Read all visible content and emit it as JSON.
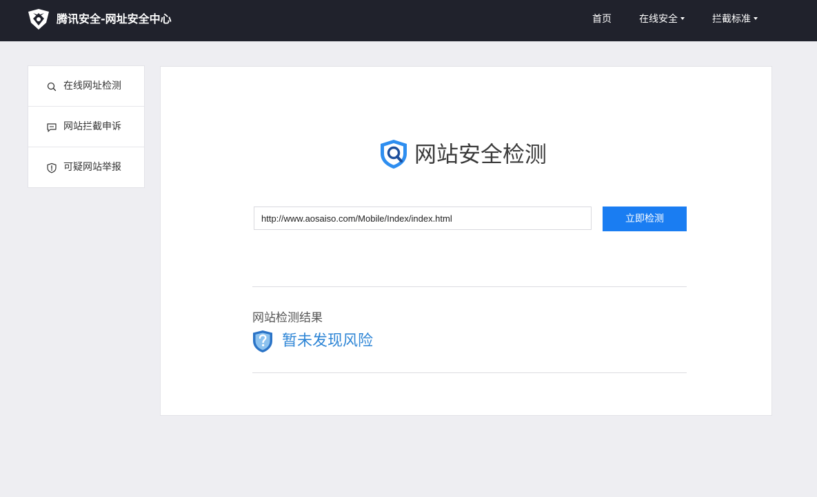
{
  "header": {
    "brand": "腾讯安全-网址安全中心",
    "logo_icon": "tencent-security-logo-icon",
    "nav": [
      {
        "label": "首页",
        "has_caret": false
      },
      {
        "label": "在线安全",
        "has_caret": true
      },
      {
        "label": "拦截标准",
        "has_caret": true
      }
    ]
  },
  "sidebar": {
    "items": [
      {
        "label": "在线网址检测",
        "icon": "search-icon"
      },
      {
        "label": "网站拦截申诉",
        "icon": "comment-icon"
      },
      {
        "label": "可疑网站举报",
        "icon": "shield-alert-icon"
      }
    ]
  },
  "main": {
    "title": "网站安全检测",
    "title_icon": "shield-search-icon",
    "url_input": {
      "value": "http://www.aosaiso.com/Mobile/Index/index.html",
      "placeholder": ""
    },
    "check_button": "立即检测",
    "result": {
      "heading": "网站检测结果",
      "status": "暂未发现风险",
      "status_icon": "shield-question-icon"
    }
  },
  "colors": {
    "topbar": "#20222c",
    "page_bg": "#eeeef2",
    "accent_blue": "#1a7df2",
    "result_blue": "#2f86d6",
    "text_dark": "#333333"
  }
}
